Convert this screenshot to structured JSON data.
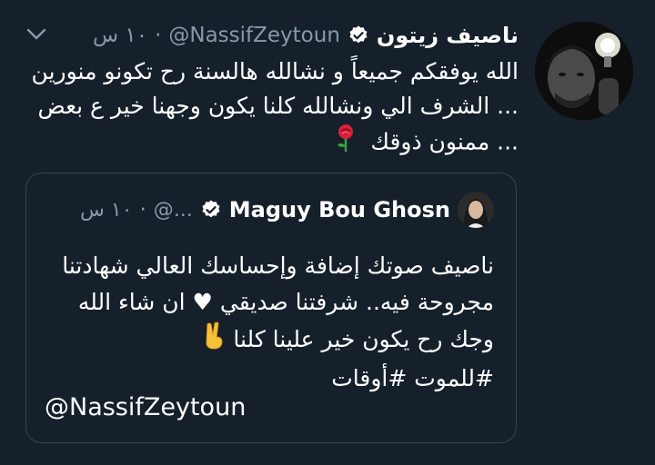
{
  "tweet": {
    "author_name": "ناصيف زيتون",
    "handle": "@NassifZeytoun",
    "separator": "·",
    "time": "١٠ س",
    "body": "الله يوفقكم جميعاً و نشالله هالسنة رح تكونو منورين ... الشرف الي ونشالله كلنا يكون وجهنا خير ع بعض ... ممنون ذوقك",
    "body_emoji": "rose",
    "more_icon": "chevron-down-icon",
    "verified_icon": "verified-badge-icon"
  },
  "quote": {
    "author_name": "Maguy Bou Ghosn",
    "handle": "@...",
    "separator": "·",
    "time": "١٠ س",
    "body": "ناصيف صوتك إضافة وإحساسك العالي شهادتنا مجروحة فيه.. شرفتنا صديقي ♥ ان شاء الله وجك رح يكون خير علينا كلنا",
    "body_emoji": "victory-hand",
    "hashtags": "#للموت #أوقات",
    "mention": "@NassifZeytoun"
  },
  "colors": {
    "background": "#15202b",
    "secondary_text": "#8899a6",
    "border": "#38444d",
    "verified_badge": "#ffffff"
  }
}
